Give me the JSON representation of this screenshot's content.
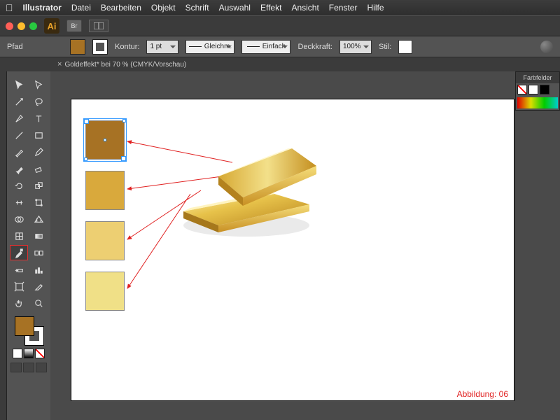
{
  "menubar": {
    "app": "Illustrator",
    "items": [
      "Datei",
      "Bearbeiten",
      "Objekt",
      "Schrift",
      "Auswahl",
      "Effekt",
      "Ansicht",
      "Fenster",
      "Hilfe"
    ]
  },
  "titlebar": {
    "ai": "Ai",
    "br": "Br"
  },
  "optbar": {
    "pfad": "Pfad",
    "kontur": "Kontur:",
    "stroke": "1 pt",
    "dash1": "Gleichm.",
    "dash2": "Einfach",
    "deck": "Deckkraft:",
    "opacity": "100%",
    "stil": "Stil:"
  },
  "doc": {
    "tab": "Goldeffekt* bei 70 % (CMYK/Vorschau)"
  },
  "colors": {
    "sq1": "#a77224",
    "sq2": "#d9a93c",
    "sq3": "#edcf72",
    "sq4": "#f0e087"
  },
  "panel": {
    "title": "Farbfelder"
  },
  "caption": "Abbildung: 06"
}
